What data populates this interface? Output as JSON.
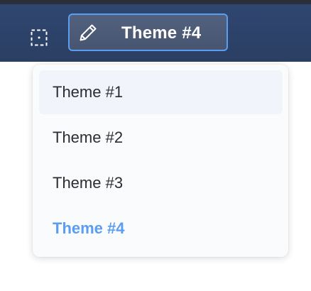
{
  "toolbar": {
    "select_icon": "dashed-selection-icon",
    "theme_button": {
      "icon": "pencil-icon",
      "label": "Theme #4"
    }
  },
  "dropdown": {
    "items": [
      {
        "label": "Theme #1",
        "state": "hover"
      },
      {
        "label": "Theme #2",
        "state": "normal"
      },
      {
        "label": "Theme #3",
        "state": "normal"
      },
      {
        "label": "Theme #4",
        "state": "selected"
      }
    ]
  },
  "colors": {
    "toolbar_bg": "#2f4670",
    "accent": "#5b9df0",
    "menu_bg": "#fafbfc",
    "hover_bg": "#f1f5fb",
    "text": "#2a2d33"
  }
}
